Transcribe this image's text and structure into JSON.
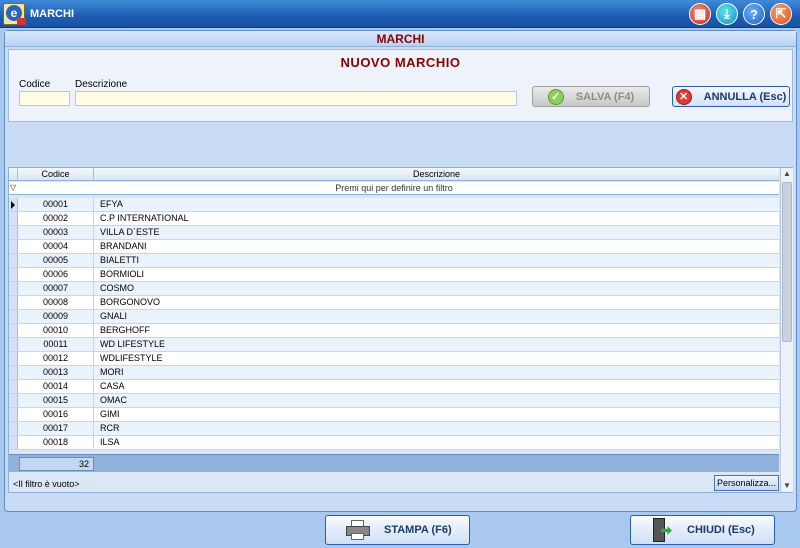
{
  "window": {
    "title": "MARCHI"
  },
  "header": {
    "title": "MARCHI"
  },
  "form": {
    "title": "NUOVO MARCHIO",
    "codice_label": "Codice",
    "codice_value": "",
    "descrizione_label": "Descrizione",
    "descrizione_value": "",
    "save_label": "SALVA (F4)",
    "cancel_label": "ANNULLA  (Esc)"
  },
  "grid": {
    "col_codice": "Codice",
    "col_descrizione": "Descrizione",
    "filter_prompt": "Premi qui per definire un filtro",
    "rows": [
      {
        "codice": "00001",
        "descrizione": "EFYA"
      },
      {
        "codice": "00002",
        "descrizione": "C.P INTERNATIONAL"
      },
      {
        "codice": "00003",
        "descrizione": "VILLA D`ESTE"
      },
      {
        "codice": "00004",
        "descrizione": "BRANDANI"
      },
      {
        "codice": "00005",
        "descrizione": "BIALETTI"
      },
      {
        "codice": "00006",
        "descrizione": "BORMIOLI"
      },
      {
        "codice": "00007",
        "descrizione": "COSMO"
      },
      {
        "codice": "00008",
        "descrizione": "BORGONOVO"
      },
      {
        "codice": "00009",
        "descrizione": "GNALI"
      },
      {
        "codice": "00010",
        "descrizione": "BERGHOFF"
      },
      {
        "codice": "00011",
        "descrizione": "WD LIFESTYLE"
      },
      {
        "codice": "00012",
        "descrizione": "WDLIFESTYLE"
      },
      {
        "codice": "00013",
        "descrizione": "MORI"
      },
      {
        "codice": "00014",
        "descrizione": "CASA"
      },
      {
        "codice": "00015",
        "descrizione": "OMAC"
      },
      {
        "codice": "00016",
        "descrizione": "GIMI"
      },
      {
        "codice": "00017",
        "descrizione": "RCR"
      },
      {
        "codice": "00018",
        "descrizione": "ILSA"
      }
    ],
    "total_count": "32",
    "filter_status": "<Il filtro è vuoto>",
    "customize_label": "Personalizza..."
  },
  "footer": {
    "print_label": "STAMPA  (F6)",
    "close_label": "CHIUDI   (Esc)"
  },
  "icons": {
    "calculator": "calculator-icon",
    "download": "download-icon",
    "help": "help-icon",
    "exit": "exit-icon"
  },
  "colors": {
    "title_red": "#8b0000",
    "titlebar_blue": "#1d5db3",
    "background": "#a8c8ee"
  }
}
